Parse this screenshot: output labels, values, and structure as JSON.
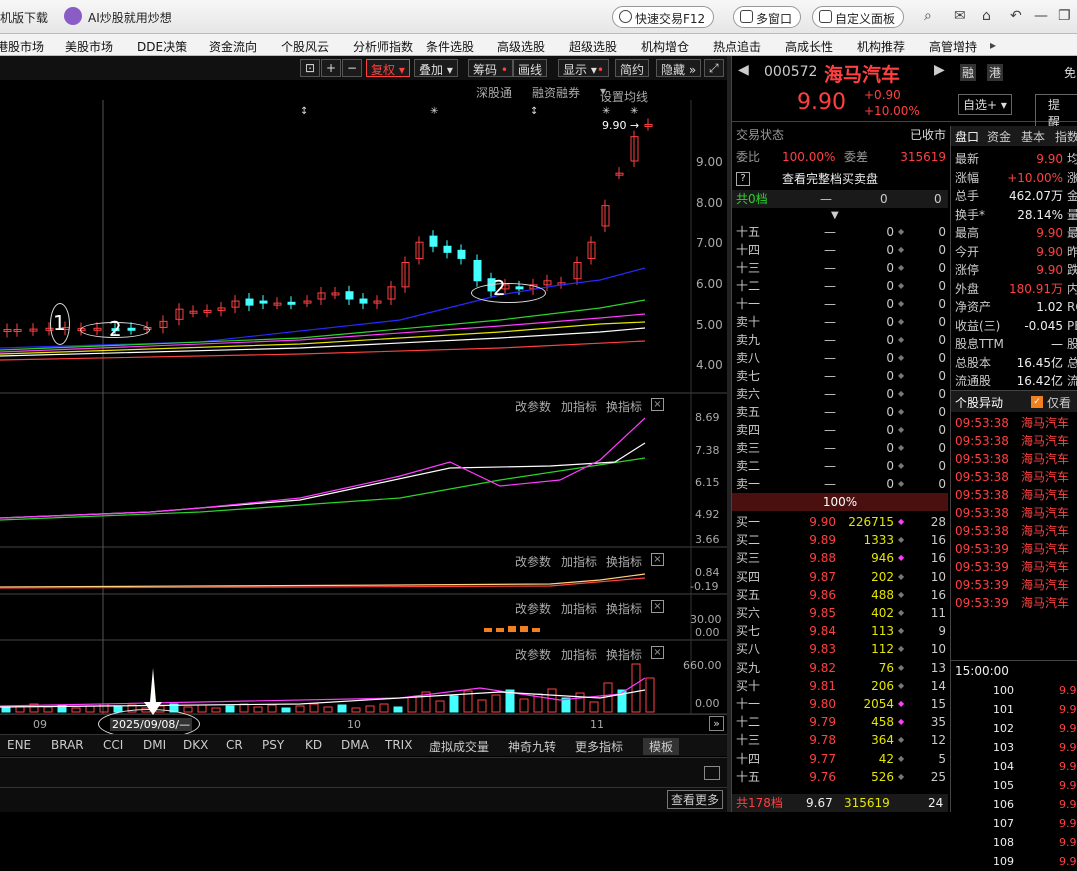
{
  "topbar": {
    "download": "机版下载",
    "ai_label": "AI炒股就用炒想",
    "quick_trade": "快速交易F12",
    "multi_window": "多窗口",
    "custom_panel": "自定义面板"
  },
  "menu": [
    "港股市场",
    "美股市场",
    "DDE决策",
    "资金流向",
    "个股风云",
    "分析师指数",
    "条件选股",
    "高级选股",
    "超级选股",
    "机构增仓",
    "热点追击",
    "高成长性",
    "机构推荐",
    "高管增持"
  ],
  "chart_toolbar": {
    "restore": "复权",
    "overlay": "叠加",
    "chips": "筹码",
    "draw": "画线",
    "show": "显示",
    "simple": "简约",
    "hide": "隐藏"
  },
  "chart_sub": {
    "shen": "深股通",
    "margin": "融资融券",
    "ma_settings": "设置均线"
  },
  "price_labels": [
    "9.00",
    "8.00",
    "7.00",
    "6.00",
    "5.00",
    "4.00"
  ],
  "last_price_tag": "9.90",
  "annotations": {
    "circle1": "1",
    "circle2a": "2",
    "circle2b": "2",
    "date_marker": "2025/09/08/—"
  },
  "panels": {
    "p2": {
      "btn1": "改参数",
      "btn2": "加指标",
      "btn3": "换指标",
      "y": [
        "8.69",
        "7.38",
        "6.15",
        "4.92",
        "3.66"
      ]
    },
    "p3": {
      "btn1": "改参数",
      "btn2": "加指标",
      "btn3": "换指标",
      "y": [
        "0.84",
        "-0.19"
      ]
    },
    "p4": {
      "btn1": "改参数",
      "btn2": "加指标",
      "btn3": "换指标",
      "y": [
        "30.00",
        "0.00"
      ]
    },
    "p5": {
      "btn1": "改参数",
      "btn2": "加指标",
      "btn3": "换指标",
      "y": [
        "660.00",
        "0.00"
      ]
    }
  },
  "x_axis": [
    "09",
    "10",
    "11"
  ],
  "indicator_tabs": [
    "ENE",
    "BRAR",
    "CCI",
    "DMI",
    "DKX",
    "CR",
    "PSY",
    "KD",
    "DMA",
    "TRIX",
    "虚拟成交量",
    "神奇九转",
    "更多指标",
    "模板"
  ],
  "stock": {
    "code": "000572",
    "name": "海马汽车",
    "price": "9.90",
    "change": "+0.90",
    "pct": "+10.00%",
    "tag1": "融",
    "tag2": "港",
    "free": "免",
    "watch": "自选+",
    "alert": "提醒"
  },
  "status": {
    "label": "交易状态",
    "value": "已收市",
    "wb_label": "委比",
    "wb": "100.00%",
    "wc_label": "委差",
    "wc": "315619",
    "full_book": "查看完整档买卖盘",
    "total_label": "共0档",
    "total_v1": "0",
    "total_v2": "0",
    "mid_pct": "100%",
    "foot_label": "共178档",
    "foot_price": "9.67",
    "foot_vol": "315619",
    "foot_cnt": "24"
  },
  "sell_levels": [
    {
      "label": "十五",
      "price": "—",
      "vol": "0",
      "cnt": "0"
    },
    {
      "label": "十四",
      "price": "—",
      "vol": "0",
      "cnt": "0"
    },
    {
      "label": "十三",
      "price": "—",
      "vol": "0",
      "cnt": "0"
    },
    {
      "label": "十二",
      "price": "—",
      "vol": "0",
      "cnt": "0"
    },
    {
      "label": "十一",
      "price": "—",
      "vol": "0",
      "cnt": "0"
    },
    {
      "label": "卖十",
      "price": "—",
      "vol": "0",
      "cnt": "0"
    },
    {
      "label": "卖九",
      "price": "—",
      "vol": "0",
      "cnt": "0"
    },
    {
      "label": "卖八",
      "price": "—",
      "vol": "0",
      "cnt": "0"
    },
    {
      "label": "卖七",
      "price": "—",
      "vol": "0",
      "cnt": "0"
    },
    {
      "label": "卖六",
      "price": "—",
      "vol": "0",
      "cnt": "0"
    },
    {
      "label": "卖五",
      "price": "—",
      "vol": "0",
      "cnt": "0"
    },
    {
      "label": "卖四",
      "price": "—",
      "vol": "0",
      "cnt": "0"
    },
    {
      "label": "卖三",
      "price": "—",
      "vol": "0",
      "cnt": "0"
    },
    {
      "label": "卖二",
      "price": "—",
      "vol": "0",
      "cnt": "0"
    },
    {
      "label": "卖一",
      "price": "—",
      "vol": "0",
      "cnt": "0"
    }
  ],
  "buy_levels": [
    {
      "label": "买一",
      "price": "9.90",
      "vol": "226715",
      "cnt": "28",
      "dot": "mag"
    },
    {
      "label": "买二",
      "price": "9.89",
      "vol": "1333",
      "cnt": "16",
      "dot": "gray"
    },
    {
      "label": "买三",
      "price": "9.88",
      "vol": "946",
      "cnt": "16",
      "dot": "mag"
    },
    {
      "label": "买四",
      "price": "9.87",
      "vol": "202",
      "cnt": "10",
      "dot": "gray"
    },
    {
      "label": "买五",
      "price": "9.86",
      "vol": "488",
      "cnt": "16",
      "dot": "gray"
    },
    {
      "label": "买六",
      "price": "9.85",
      "vol": "402",
      "cnt": "11",
      "dot": "gray"
    },
    {
      "label": "买七",
      "price": "9.84",
      "vol": "113",
      "cnt": "9",
      "dot": "gray"
    },
    {
      "label": "买八",
      "price": "9.83",
      "vol": "112",
      "cnt": "10",
      "dot": "gray"
    },
    {
      "label": "买九",
      "price": "9.82",
      "vol": "76",
      "cnt": "13",
      "dot": "gray"
    },
    {
      "label": "买十",
      "price": "9.81",
      "vol": "206",
      "cnt": "14",
      "dot": "gray"
    },
    {
      "label": "十一",
      "price": "9.80",
      "vol": "2054",
      "cnt": "15",
      "dot": "mag"
    },
    {
      "label": "十二",
      "price": "9.79",
      "vol": "458",
      "cnt": "35",
      "dot": "mag"
    },
    {
      "label": "十三",
      "price": "9.78",
      "vol": "364",
      "cnt": "12",
      "dot": "gray"
    },
    {
      "label": "十四",
      "price": "9.77",
      "vol": "42",
      "cnt": "5",
      "dot": "gray"
    },
    {
      "label": "十五",
      "price": "9.76",
      "vol": "526",
      "cnt": "25",
      "dot": "gray"
    }
  ],
  "quote_tabs": [
    "盘口",
    "资金",
    "基本",
    "指数"
  ],
  "quote": [
    {
      "k": "最新",
      "v": "9.90",
      "c": "red",
      "k2": "均"
    },
    {
      "k": "涨幅",
      "v": "+10.00%",
      "c": "red",
      "k2": "涨"
    },
    {
      "k": "总手",
      "v": "462.07万",
      "c": "white",
      "k2": "金"
    },
    {
      "k": "换手*",
      "v": "28.14%",
      "c": "white",
      "k2": "量"
    },
    {
      "k": "最高",
      "v": "9.90",
      "c": "red",
      "k2": "最"
    },
    {
      "k": "今开",
      "v": "9.90",
      "c": "red",
      "k2": "昨"
    },
    {
      "k": "涨停",
      "v": "9.90",
      "c": "red",
      "k2": "跌"
    },
    {
      "k": "外盘",
      "v": "180.91万",
      "c": "red",
      "k2": "内"
    },
    {
      "k": "净资产",
      "v": "1.02",
      "c": "white",
      "k2": "RO"
    },
    {
      "k": "收益(三)",
      "v": "-0.045",
      "c": "white",
      "k2": "PE"
    },
    {
      "k": "股息TTM",
      "v": "—",
      "c": "white",
      "k2": "股"
    },
    {
      "k": "总股本",
      "v": "16.45亿",
      "c": "white",
      "k2": "总"
    },
    {
      "k": "流通股",
      "v": "16.42亿",
      "c": "white",
      "k2": "流"
    }
  ],
  "movement": {
    "title": "个股异动",
    "only": "仅看",
    "rows": [
      {
        "t": "09:53:38",
        "n": "海马汽车"
      },
      {
        "t": "09:53:38",
        "n": "海马汽车"
      },
      {
        "t": "09:53:38",
        "n": "海马汽车"
      },
      {
        "t": "09:53:38",
        "n": "海马汽车"
      },
      {
        "t": "09:53:38",
        "n": "海马汽车"
      },
      {
        "t": "09:53:38",
        "n": "海马汽车"
      },
      {
        "t": "09:53:38",
        "n": "海马汽车"
      },
      {
        "t": "09:53:39",
        "n": "海马汽车"
      },
      {
        "t": "09:53:39",
        "n": "海马汽车"
      },
      {
        "t": "09:53:39",
        "n": "海马汽车"
      },
      {
        "t": "09:53:39",
        "n": "海马汽车"
      }
    ]
  },
  "ticks": {
    "time": "15:00:00",
    "rows": [
      "100",
      "101",
      "102",
      "103",
      "104",
      "105",
      "106",
      "107",
      "108",
      "109"
    ],
    "price": "9.9"
  },
  "see_more": "查看更多",
  "colors": {
    "up": "#ff4040",
    "down": "#4ff",
    "ma5": "#ffffff",
    "ma10": "#e6e600",
    "ma20": "#ff3cff",
    "ma30": "#2bd42b",
    "ma60": "#2929ff",
    "ma120": "#ff4040"
  }
}
